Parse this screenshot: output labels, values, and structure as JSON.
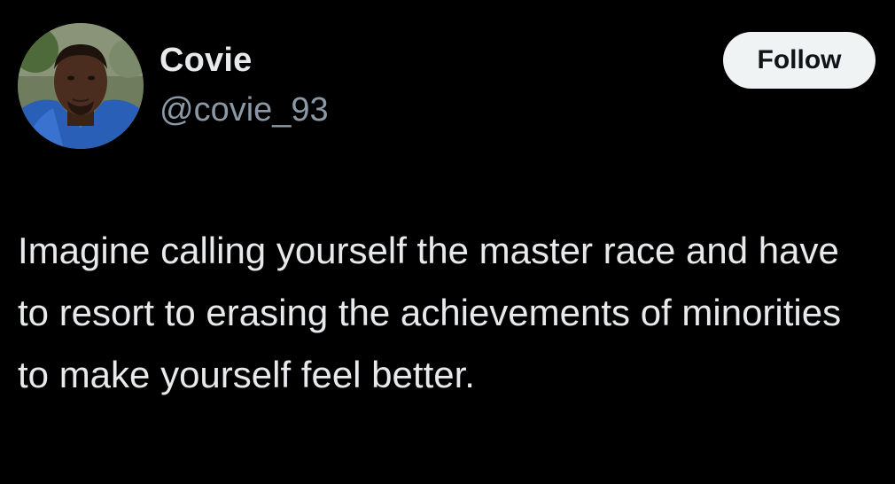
{
  "author": {
    "display_name": "Covie",
    "handle": "@covie_93",
    "avatar_icon": "profile-photo"
  },
  "follow_button": {
    "label": "Follow"
  },
  "tweet": {
    "text": "Imagine calling yourself the master race and have to resort to erasing the achievements of minorities to make yourself feel better."
  },
  "colors": {
    "background": "#000000",
    "primary_text": "#e7e9ea",
    "secondary_text": "#8b98a5",
    "follow_bg": "#eff3f4",
    "follow_text": "#0f1419"
  }
}
